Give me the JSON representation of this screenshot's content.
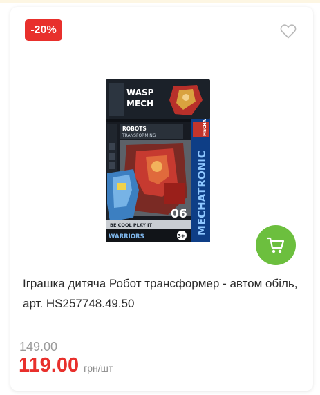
{
  "product": {
    "discount_badge": "-20%",
    "title": "Іграшка дитяча Робот трансформер - автом обіль, арт. HS257748.49.50",
    "old_price": "149.00",
    "price": "119.00",
    "unit": "грн/шт",
    "image_alt": "Robot transformer toy box"
  },
  "box": {
    "brand_line1": "WASP",
    "brand_line2": "MECH",
    "banner_line1": "ROBOTS",
    "banner_line2": "TRANSFORMING",
    "side_text": "MECHATRONIC",
    "side_top": "MECHA",
    "number": "06",
    "slogan": "BE COOL PLAY IT",
    "footer": "WARRIORS",
    "age": "3+"
  },
  "icons": {
    "wishlist": "heart-outline-icon",
    "cart": "shopping-cart-icon"
  },
  "colors": {
    "accent_red": "#e8302c",
    "cart_green": "#6cbf3e",
    "text_dark": "#2b2b2b",
    "muted": "#9a9a9a"
  }
}
